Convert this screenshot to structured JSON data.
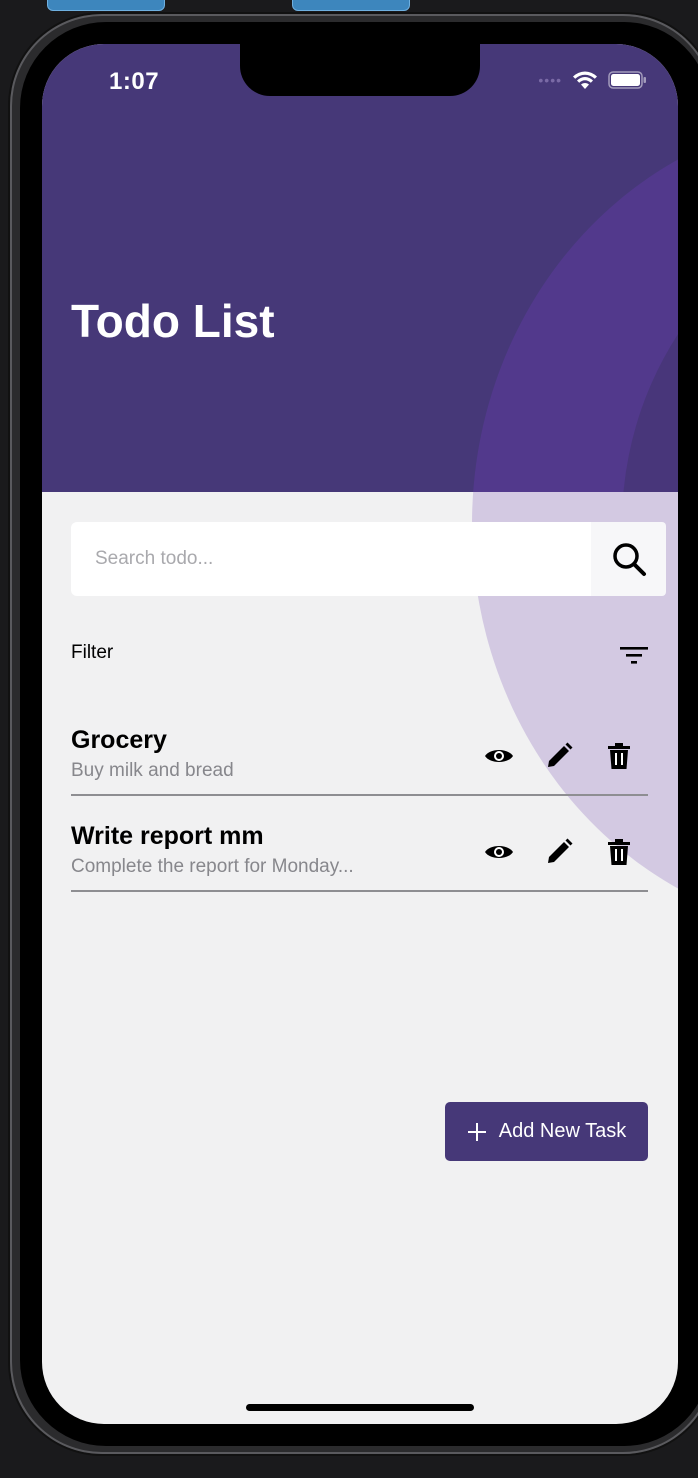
{
  "status_bar": {
    "time": "1:07",
    "dots": "••••"
  },
  "header": {
    "title": "Todo List"
  },
  "search": {
    "placeholder": "Search todo...",
    "value": ""
  },
  "filter": {
    "label": "Filter"
  },
  "tasks": [
    {
      "title": "Grocery",
      "description": "Buy milk and bread"
    },
    {
      "title": "Write report mm",
      "description": "Complete the report for Monday..."
    }
  ],
  "add_button": {
    "label": "Add New Task"
  },
  "icons": {
    "search": "search-icon",
    "filter": "filter-icon",
    "view": "eye-icon",
    "edit": "pencil-icon",
    "delete": "trash-icon",
    "add": "plus-icon"
  },
  "colors": {
    "accent": "#463878",
    "header_bg": "#463878",
    "screen_bg": "#f1f1f2"
  }
}
